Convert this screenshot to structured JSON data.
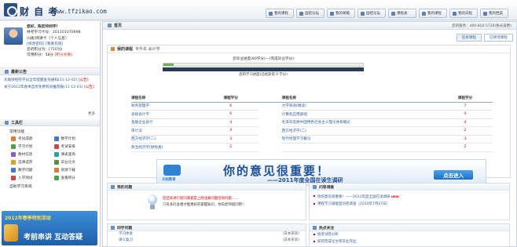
{
  "header": {
    "logo_text": "财 自 考 ",
    "url_text": "www.tfzikao.com",
    "nav": [
      "我的课程",
      "固结论坛",
      "我的邮箱",
      "固结论坛",
      "课程表",
      "我的课程",
      "我的日程",
      "我的档案",
      "修改登"
    ]
  },
  "profile": {
    "name": "您好，陈宏玲同学！",
    "line2": "林考学习卡号：201101070698",
    "line3": "(0类)购课卡（个人信息）",
    "links": "[修改密码]  [我要充值]",
    "points": "您的积分为：[710]分",
    "usable": "可用积分：58分",
    "usable_red": "[积分兑换]"
  },
  "notices": {
    "title": "最新公告",
    "items": [
      {
        "text": "天助财经院学员全年提醒查询通知(11-12-02)",
        "tag": "[公告]"
      },
      {
        "text": "关于2012年春季自考免费有效推荐报(11-12-01)",
        "tag": "[公告]"
      }
    ],
    "more": "更多"
  },
  "tools": {
    "title": "工具栏",
    "subhead": "常用功能",
    "items": [
      "考试成绩",
      "数学计划",
      "学习计划",
      "考试安排",
      "教材信息",
      "课表查询",
      "选课选序",
      "毕业论文",
      "数学问题",
      "资源下载",
      "入学测试",
      "查看积分"
    ],
    "subhead2": "自助学习系统"
  },
  "ad": {
    "line1": "2012年春季特别活动",
    "line2": "考前串讲 互动答疑"
  },
  "main": {
    "title": "首页",
    "hotline": "您的服务：400-810-5726(免长途费)",
    "tabs": [
      "在修课程",
      "已修完课程"
    ]
  },
  "course": {
    "title": "我的课程",
    "subtitle": "专升本 会计学",
    "progress_text": "您毕业进度(80学分)---(完成毕业学分)",
    "progress_red": "(完成毕业学分)",
    "progress_note": "您的学习进度(已经获得 0 学分)",
    "progress_fraction": 0.05,
    "col_name": "课程名称",
    "col_credit": "课程学分",
    "left": [
      {
        "name": "财务管理学",
        "credit": "6"
      },
      {
        "name": "高级会计学",
        "credit": "6"
      },
      {
        "name": "金融企业会计",
        "credit": "4"
      },
      {
        "name": "审计法",
        "credit": "4"
      },
      {
        "name": "西方经济学(二)",
        "credit": "3"
      },
      {
        "name": "政治经济学(财经类)",
        "credit": "2"
      }
    ],
    "right": [
      {
        "name": "大学英语(精读)",
        "credit": "7"
      },
      {
        "name": "计算机应用基础",
        "credit": "4"
      },
      {
        "name": "毛泽东思想中国特色社会主义理论体系概论",
        "credit": "4"
      },
      {
        "name": "西方经济学(二)",
        "credit": "2"
      },
      {
        "name": "现代经理学习概论",
        "credit": "3"
      },
      {
        "name": "",
        "credit": "2"
      }
    ]
  },
  "banner": {
    "logo": "天助教育",
    "headline": "你的意见很重要！",
    "sub": "——2011年度全国在读生调研",
    "cta": "点击进入"
  },
  "questions": {
    "title": "我的问题",
    "line1": "您还未进行提问或者是上网注册问题咨询问题……",
    "line2": "只有多问多想才能更好的掌握知识，你向老师提问吧！"
  },
  "survey": {
    "title": "问卷调查",
    "items": [
      {
        "text": "你的意见很重要！——2011年度全国在读调研",
        "new": "NEW"
      },
      {
        "text": "课程学习满意度问卷调查（2010年7月27日）",
        "new": ""
      }
    ]
  },
  "learn": {
    "title": "同学问题",
    "rows": [
      {
        "left": "学习体会",
        "right": "(日本某某)"
      },
      {
        "left": "讲义复习",
        "right": "(日本某某)"
      }
    ]
  },
  "hot": {
    "title": "热点关注",
    "items": [
      "统考试卷分析",
      "如何完成论文和毕业作业"
    ]
  }
}
